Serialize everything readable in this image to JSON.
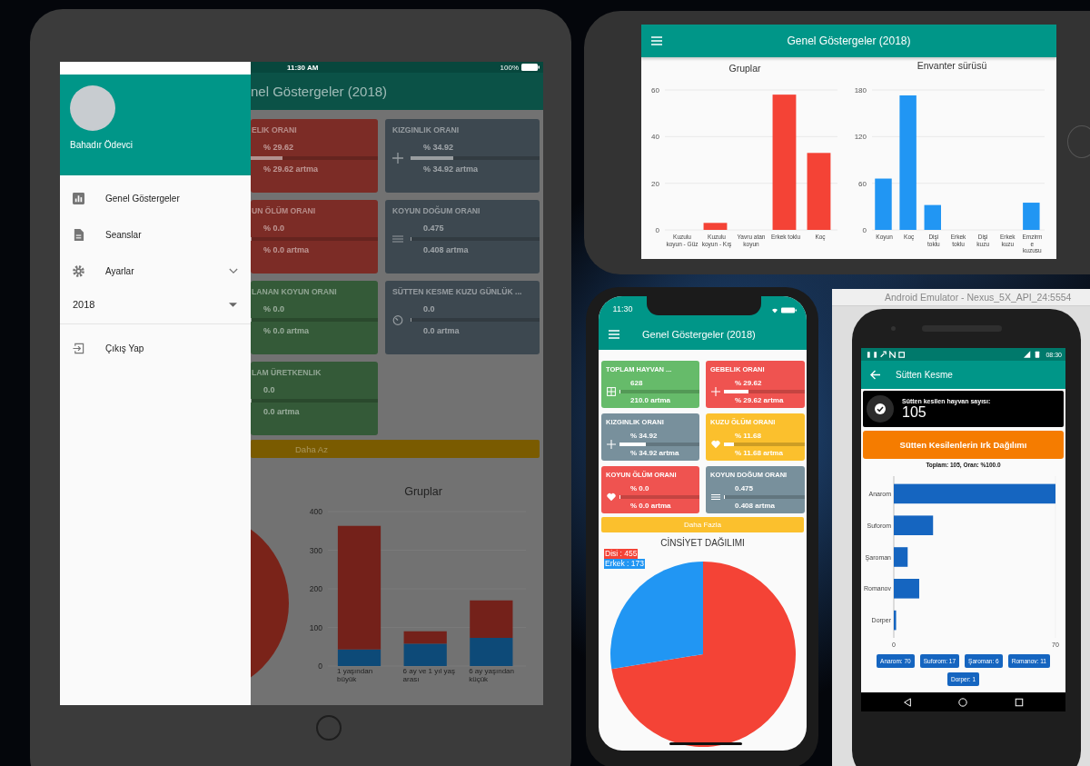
{
  "tablet": {
    "drawer": {
      "user_name": "Bahadır Ödevci",
      "items": [
        {
          "label": "Genel Göstergeler",
          "kind": "chart",
          "selected": false
        },
        {
          "label": "Seanslar",
          "kind": "document",
          "selected": false
        }
      ],
      "settings_group": {
        "label": "Ayarlar",
        "expanded": false
      },
      "year_select": {
        "value": "2018"
      },
      "logout": {
        "label": "Çıkış Yap"
      }
    },
    "status_bar": {
      "time": "11:30 AM",
      "battery": "100%"
    },
    "title": "nel Göstergeler (2018)",
    "cards": [
      {
        "title": "ELIK ORANI",
        "value": "% 29.62",
        "change": "% 29.62 artma",
        "color": "#7c2c26",
        "kind": "none",
        "level": 0.25
      },
      {
        "title": "KIZGINLIK ORANI",
        "value": "% 34.92",
        "change": "% 34.92 artma",
        "color": "#3d4850",
        "kind": "plus",
        "level": 0.33
      },
      {
        "title": "UN ÖLÜM ORANI",
        "value": "% 0.0",
        "change": "% 0.0 artma",
        "color": "#7c2c26",
        "kind": "none",
        "level": 0
      },
      {
        "title": "KOYUN DOĞUM ORANI",
        "value": "0.475",
        "change": "0.408 artma",
        "color": "#3d4850",
        "kind": "lines",
        "level": 0
      },
      {
        "title": "LANAN KOYUN ORANI",
        "value": "% 0.0",
        "change": "% 0.0 artma",
        "color": "#345a38",
        "kind": "none",
        "level": 0
      },
      {
        "title": "SÜTTEN KESME KUZU GÜNLÜK ...",
        "value": "0.0",
        "change": "0.0 artma",
        "color": "#3d4850",
        "kind": "timer",
        "level": 0
      },
      {
        "title": "LAM ÜRETKENLIK",
        "value": "0.0",
        "change": "0.0 artma",
        "color": "#345a38",
        "kind": "none",
        "level": 0
      }
    ],
    "toggle_button": "Daha Az",
    "chart_data": {
      "type": "bar",
      "title": "Gruplar",
      "categories": [
        "1 yaşından büyük",
        "6 ay ve 1 yıl yaş arası",
        "6 ay yaşından küçük"
      ],
      "stacked": true,
      "ylim": [
        0,
        400
      ],
      "yticks": [
        0,
        100,
        200,
        300,
        400
      ],
      "series": [
        {
          "color": "#0d4a78",
          "values": [
            43,
            58,
            73
          ]
        },
        {
          "color": "#74211a",
          "values": [
            320,
            32,
            97
          ]
        }
      ]
    }
  },
  "landscape_phone": {
    "title": "Genel Göstergeler (2018)",
    "charts": [
      {
        "chart_data": {
          "type": "bar",
          "title": "Gruplar",
          "categories": [
            "Kuzulu koyun - Güz",
            "Kuzulu koyun - Kış",
            "Yavru atan koyun",
            "Erkek toklu",
            "Koç"
          ],
          "ylim": [
            0,
            60
          ],
          "yticks": [
            0,
            20,
            40,
            60
          ],
          "series": [
            {
              "color": "#f44336",
              "values": [
                0,
                3,
                0,
                58,
                33
              ]
            }
          ]
        }
      },
      {
        "chart_data": {
          "type": "bar",
          "title": "Envanter sürüsü",
          "categories": [
            "Koyun",
            "Koç",
            "Dişi toklu",
            "Erkek toklu",
            "Dişi kuzu",
            "Erkek kuzu",
            "Emzirme kuzusu"
          ],
          "ylim": [
            0,
            180
          ],
          "yticks": [
            0,
            60,
            120,
            180
          ],
          "series": [
            {
              "color": "#2196f3",
              "values": [
                66,
                173,
                32,
                0,
                0,
                0,
                35
              ]
            }
          ]
        }
      }
    ]
  },
  "phone": {
    "status_bar": {
      "time": "11:30"
    },
    "title": "Genel Göstergeler (2018)",
    "cards": [
      {
        "title": "TOPLAM HAYVAN ...",
        "value": "628",
        "change": "210.0 artma",
        "color": "#66bb6a",
        "kind": "grid",
        "level": 0
      },
      {
        "title": "GEBELIK ORANI",
        "value": "% 29.62",
        "change": "% 29.62 artma",
        "color": "#ef5350",
        "kind": "plus",
        "level": 0.3
      },
      {
        "title": "KIZGINLIK ORANI",
        "value": "% 34.92",
        "change": "% 34.92 artma",
        "color": "#78909c",
        "kind": "plus",
        "level": 0.33
      },
      {
        "title": "KUZU ÖLÜM ORANI",
        "value": "% 11.68",
        "change": "% 11.68 artma",
        "color": "#fbc02d",
        "kind": "heart",
        "level": 0.12
      },
      {
        "title": "KOYUN ÖLÜM ORANI",
        "value": "% 0.0",
        "change": "% 0.0 artma",
        "color": "#ef5350",
        "kind": "heart",
        "level": 0
      },
      {
        "title": "KOYUN DOĞUM ORANI",
        "value": "0.475",
        "change": "0.408 artma",
        "color": "#78909c",
        "kind": "lines",
        "level": 0
      }
    ],
    "toggle_button": "Daha Fazla",
    "legend": [
      {
        "label": "Disi : 455",
        "color": "#f44336"
      },
      {
        "label": "Erkek : 173",
        "color": "#2196f3"
      }
    ],
    "chart_data": {
      "type": "pie",
      "title": "CİNSİYET DAĞILIMI",
      "values": [
        72.45,
        27.55
      ]
    }
  },
  "emulator": {
    "window_title": "Android Emulator - Nexus_5X_API_24:5554",
    "status_bar": {
      "time": "08:30"
    },
    "title": "Sütten Kesme",
    "summary": {
      "label": "Sütten kesilen hayvan sayısı:",
      "value": "105"
    },
    "section_button": "Sütten Kesilenlerin Irk Dağılımı",
    "total": "Toplam: 105, Oran: %100.0",
    "chart_data": {
      "type": "bar",
      "orientation": "horizontal",
      "categories": [
        "Anarom",
        "Suforom",
        "Şaroman",
        "Romanov",
        "Dorper"
      ],
      "xlim": [
        0,
        70
      ],
      "xticks": [
        0,
        70
      ],
      "series": [
        {
          "color": "#1565c0",
          "values": [
            70,
            17,
            6,
            11,
            1
          ]
        }
      ]
    },
    "chips": [
      "Anarom: 70",
      "Suforom: 17",
      "Şaroman: 6",
      "Romanov: 11",
      "Dorper: 1"
    ]
  }
}
